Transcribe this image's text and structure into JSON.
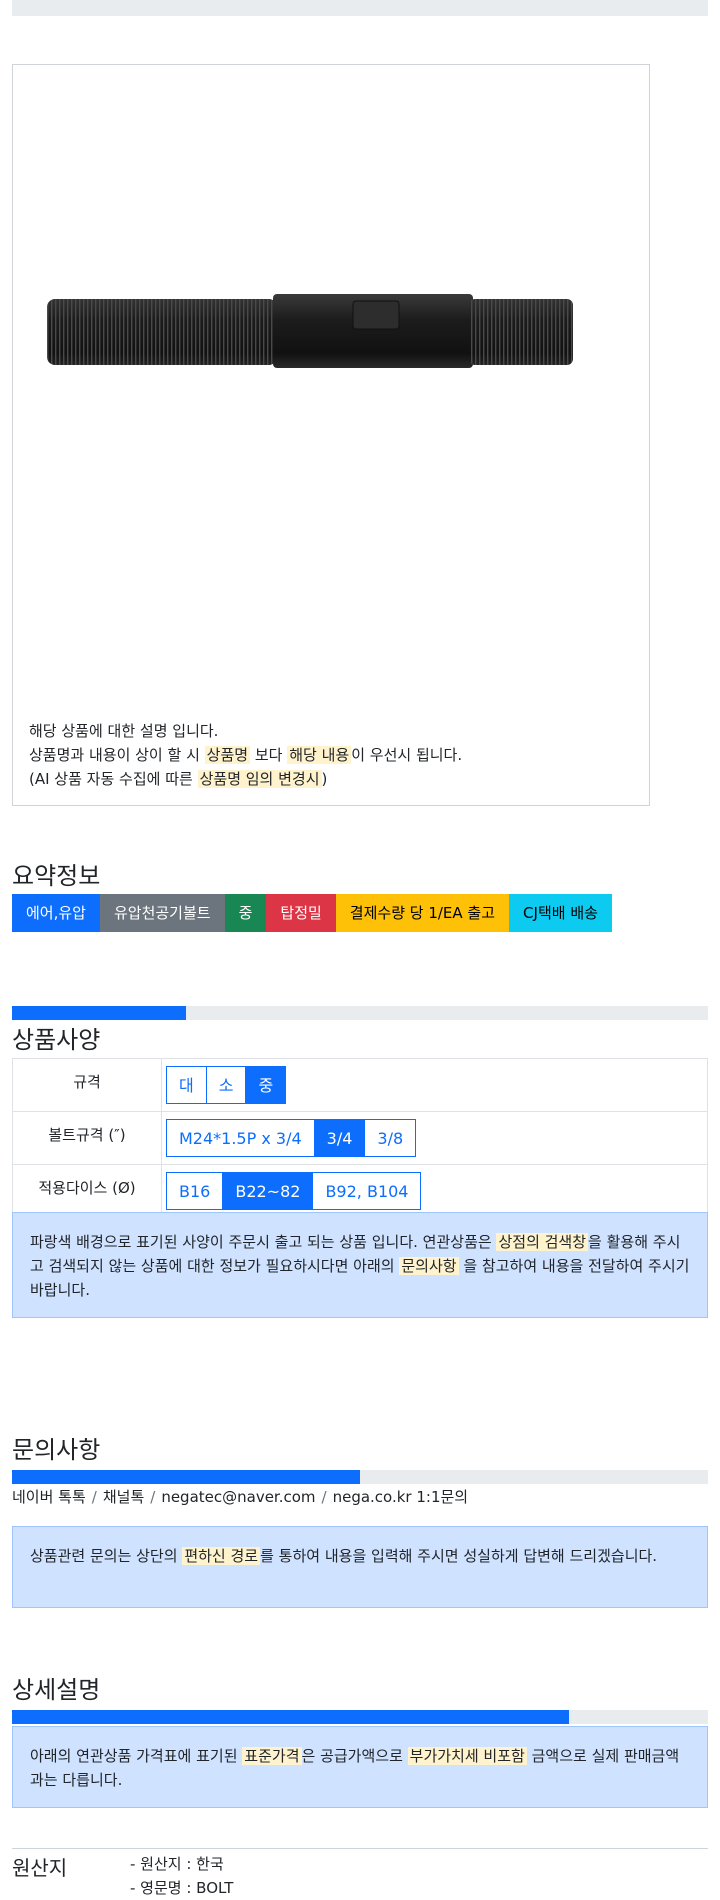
{
  "description": {
    "line1": "해당 상품에 대한 설명 입니다.",
    "line2_a": "상품명과 내용이 상이 할 시",
    "line2_hl1": "상품명",
    "line2_b": "보다",
    "line2_hl2": "해당 내용",
    "line2_c": "이 우선시 됩니다.",
    "line3_a": "(AI 상품 자동 수집에 따른",
    "line3_hl": "상품명 임의 변경시",
    "line3_b": ")"
  },
  "summary": {
    "title": "요약정보",
    "badges": [
      {
        "label": "에어,유압",
        "color": "#0d6efd"
      },
      {
        "label": "유압천공기볼트",
        "color": "#6c757d"
      },
      {
        "label": "중",
        "color": "#198754"
      },
      {
        "label": "탑정밀",
        "color": "#dc3545"
      },
      {
        "label": "결제수량 당 1/EA 출고",
        "color": "#ffc107"
      },
      {
        "label": "CJ택배 배송",
        "color": "#0dcaf0"
      }
    ]
  },
  "spec": {
    "title": "상품사양",
    "progress": 0.25,
    "rows": [
      {
        "label": "규격",
        "options": [
          {
            "text": "대",
            "selected": false
          },
          {
            "text": "소",
            "selected": false
          },
          {
            "text": "중",
            "selected": true
          }
        ]
      },
      {
        "label": "볼트규격 (″)",
        "options": [
          {
            "text": "M24*1.5P x 3/4",
            "selected": false
          },
          {
            "text": "3/4",
            "selected": true
          },
          {
            "text": "3/8",
            "selected": false
          }
        ]
      },
      {
        "label": "적용다이스 (Ø)",
        "options": [
          {
            "text": "B16",
            "selected": false
          },
          {
            "text": "B22~82",
            "selected": true
          },
          {
            "text": "B92, B104",
            "selected": false
          }
        ]
      }
    ],
    "notice_a": "파랑색 배경으로 표기된 사양이 주문시 출고 되는 상품 입니다. 연관상품은",
    "notice_hl1": "상점의 검색창",
    "notice_b": "을 활용해 주시고 검색되지 않는 상품에 대한 정보가 필요하시다면 아래의",
    "notice_hl2": "문의사항",
    "notice_c": "을 참고하여 내용을 전달하여 주시기 바랍니다."
  },
  "inquiry": {
    "title": "문의사항",
    "progress": 0.5,
    "contacts": [
      "네이버 톡톡",
      "채널톡",
      "negatec@naver.com",
      "nega.co.kr 1:1문의"
    ],
    "notice_a": "상품관련 문의는 상단의",
    "notice_hl": "편하신 경로",
    "notice_b": "를 통하여 내용을 입력해 주시면 성실하게 답변해 드리겠습니다."
  },
  "detail": {
    "title": "상세설명",
    "progress": 0.8,
    "notice_a": "아래의 연관상품 가격표에 표기된",
    "notice_hl1": "표준가격",
    "notice_b": "은 공급가액으로",
    "notice_hl2": "부가가치세 비포함",
    "notice_c": "금액으로 실제 판매금액과는 다릅니다."
  },
  "origin": {
    "title": "원산지",
    "items": [
      "- 원산지 : 한국",
      "- 영문명 : BOLT"
    ]
  }
}
